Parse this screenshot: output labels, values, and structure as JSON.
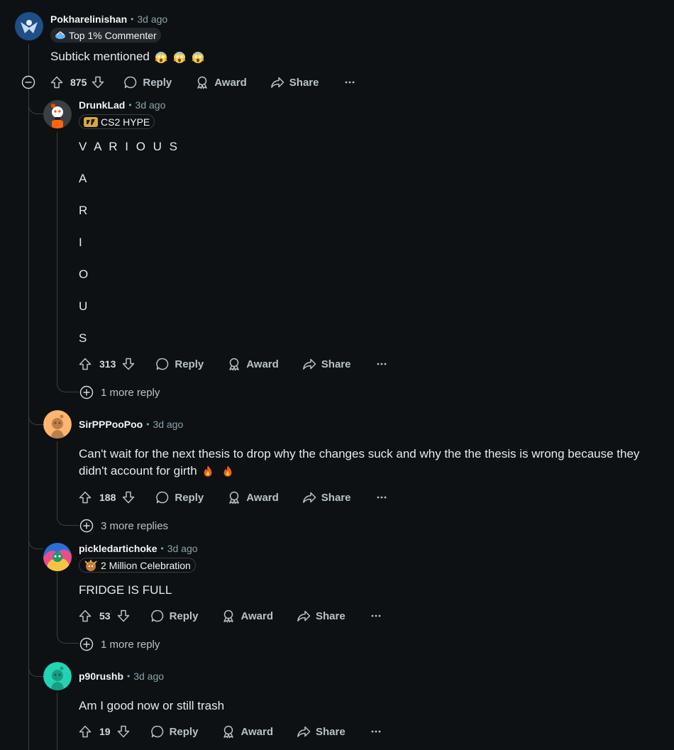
{
  "labels": {
    "reply": "Reply",
    "award": "Award",
    "share": "Share",
    "more": "···"
  },
  "comments": [
    {
      "author": "Pokharelinishan",
      "time": "3d ago",
      "flair": "Top 1% Commenter",
      "text": "Subtick mentioned",
      "votes": "875"
    },
    {
      "author": "DrunkLad",
      "time": "3d ago",
      "flair": "CS2 HYPE",
      "lines": [
        "V A R I O U S",
        "A",
        "R",
        "I",
        "O",
        "U",
        "S"
      ],
      "votes": "313",
      "more_replies": "1 more reply"
    },
    {
      "author": "SirPPPooPoo",
      "time": "3d ago",
      "text_line1": "Can't wait for the next thesis to drop why the changes suck and why the the thesis is wrong because they",
      "text_line2": "didn't account for girth",
      "votes": "188",
      "more_replies": "3 more replies"
    },
    {
      "author": "pickledartichoke",
      "time": "3d ago",
      "flair": "2 Million Celebration",
      "text": "FRIDGE IS FULL",
      "votes": "53",
      "more_replies": "1 more reply"
    },
    {
      "author": "p90rushb",
      "time": "3d ago",
      "text": "Am I good now or still trash",
      "votes": "19"
    }
  ],
  "colors": {
    "background": "#0e1113",
    "thread_line": "#3a3f44",
    "meta": "#8ba2ad"
  },
  "icons": [
    "upvote-icon",
    "downvote-icon",
    "reply-icon",
    "award-icon",
    "share-icon",
    "collapse-icon",
    "expand-icon",
    "overflow-icon",
    "fire-emoji",
    "scream-emoji"
  ]
}
